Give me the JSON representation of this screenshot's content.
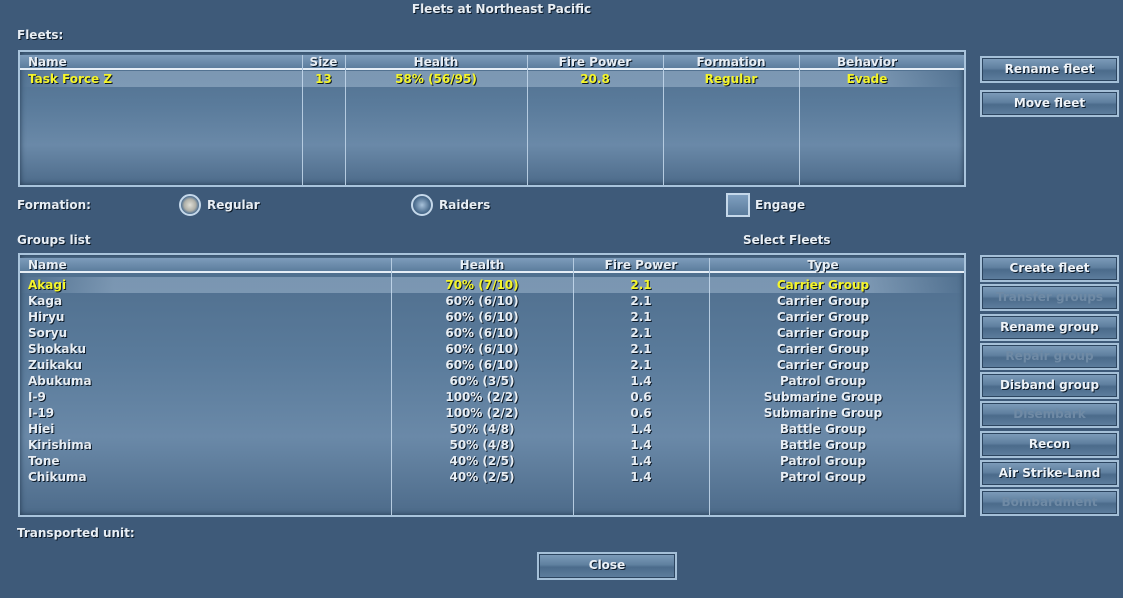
{
  "title": "Fleets at Northeast Pacific",
  "fleets_label": "Fleets:",
  "fleets_table": {
    "headers": [
      "Name",
      "Size",
      "Health",
      "Fire Power",
      "Formation",
      "Behavior"
    ],
    "rows": [
      {
        "name": "Task Force Z",
        "size": "13",
        "health": "58% (56/95)",
        "fire_power": "20.8",
        "formation": "Regular",
        "behavior": "Evade",
        "selected": true
      }
    ]
  },
  "fleet_buttons": {
    "rename": "Rename fleet",
    "move": "Move fleet"
  },
  "formation": {
    "label": "Formation:",
    "regular": "Regular",
    "raiders": "Raiders",
    "engage": "Engage",
    "selected": "Regular",
    "engage_checked": false
  },
  "groups_label": "Groups list",
  "select_fleets_label": "Select Fleets",
  "groups_table": {
    "headers": [
      "Name",
      "Health",
      "Fire Power",
      "Type"
    ],
    "rows": [
      {
        "name": "Akagi",
        "health": "70% (7/10)",
        "fire_power": "2.1",
        "type": "Carrier Group",
        "selected": true
      },
      {
        "name": "Kaga",
        "health": "60% (6/10)",
        "fire_power": "2.1",
        "type": "Carrier Group"
      },
      {
        "name": "Hiryu",
        "health": "60% (6/10)",
        "fire_power": "2.1",
        "type": "Carrier Group"
      },
      {
        "name": "Soryu",
        "health": "60% (6/10)",
        "fire_power": "2.1",
        "type": "Carrier Group"
      },
      {
        "name": "Shokaku",
        "health": "60% (6/10)",
        "fire_power": "2.1",
        "type": "Carrier Group"
      },
      {
        "name": "Zuikaku",
        "health": "60% (6/10)",
        "fire_power": "2.1",
        "type": "Carrier Group"
      },
      {
        "name": "Abukuma",
        "health": "60% (3/5)",
        "fire_power": "1.4",
        "type": "Patrol Group"
      },
      {
        "name": "I-9",
        "health": "100% (2/2)",
        "fire_power": "0.6",
        "type": "Submarine Group"
      },
      {
        "name": "I-19",
        "health": "100% (2/2)",
        "fire_power": "0.6",
        "type": "Submarine Group"
      },
      {
        "name": "Hiei",
        "health": "50% (4/8)",
        "fire_power": "1.4",
        "type": "Battle Group"
      },
      {
        "name": "Kirishima",
        "health": "50% (4/8)",
        "fire_power": "1.4",
        "type": "Battle Group"
      },
      {
        "name": "Tone",
        "health": "40% (2/5)",
        "fire_power": "1.4",
        "type": "Patrol Group"
      },
      {
        "name": "Chikuma",
        "health": "40% (2/5)",
        "fire_power": "1.4",
        "type": "Patrol Group"
      }
    ]
  },
  "group_buttons": [
    {
      "label": "Create fleet",
      "enabled": true
    },
    {
      "label": "Transfer groups",
      "enabled": false
    },
    {
      "label": "Rename group",
      "enabled": true
    },
    {
      "label": "Repair group",
      "enabled": false
    },
    {
      "label": "Disband group",
      "enabled": true
    },
    {
      "label": "Disembark",
      "enabled": false
    },
    {
      "label": "Recon",
      "enabled": true
    },
    {
      "label": "Air Strike-Land",
      "enabled": true
    },
    {
      "label": "Bombardment",
      "enabled": false
    }
  ],
  "transported_label": "Transported unit:",
  "close_label": "Close"
}
